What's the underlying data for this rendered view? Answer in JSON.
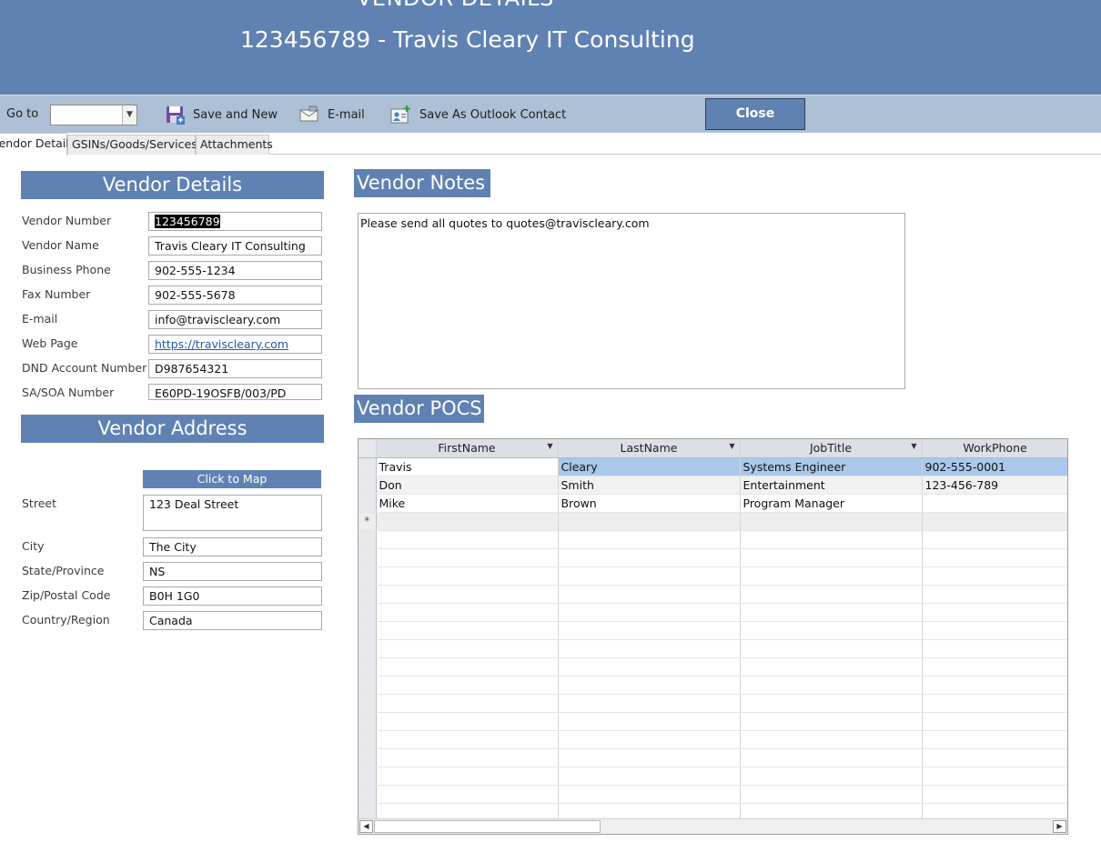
{
  "header": {
    "title": "VENDOR DETAILS",
    "subtitle": "123456789 - Travis Cleary IT Consulting"
  },
  "toolbar": {
    "goto_label": "Go to",
    "goto_value": "",
    "save_new_label": "Save and New",
    "email_label": "E-mail",
    "outlook_label": "Save As Outlook Contact",
    "close_label": "Close"
  },
  "tabs": [
    {
      "label": "Vendor Details"
    },
    {
      "label": "GSINs/Goods/Services"
    },
    {
      "label": "Attachments"
    }
  ],
  "vendor_details": {
    "heading": "Vendor Details",
    "fields": [
      {
        "label": "Vendor Number",
        "value": "123456789"
      },
      {
        "label": "Vendor Name",
        "value": "Travis Cleary IT Consulting"
      },
      {
        "label": "Business Phone",
        "value": "902-555-1234"
      },
      {
        "label": "Fax Number",
        "value": "902-555-5678"
      },
      {
        "label": "E-mail",
        "value": "info@traviscleary.com"
      },
      {
        "label": "Web Page",
        "value": "https://traviscleary.com"
      },
      {
        "label": "DND Account Number",
        "value": "D987654321"
      },
      {
        "label": "SA/SOA Number",
        "value": "E60PD-19OSFB/003/PD"
      }
    ]
  },
  "vendor_address": {
    "heading": "Vendor Address",
    "map_button": "Click to Map",
    "fields": [
      {
        "label": "Street",
        "value": "123 Deal Street"
      },
      {
        "label": "City",
        "value": "The City"
      },
      {
        "label": "State/Province",
        "value": "NS"
      },
      {
        "label": "Zip/Postal Code",
        "value": "B0H 1G0"
      },
      {
        "label": "Country/Region",
        "value": "Canada"
      }
    ]
  },
  "vendor_notes": {
    "heading": "Vendor Notes",
    "text": "Please send all quotes to quotes@traviscleary.com"
  },
  "vendor_pocs": {
    "heading": "Vendor POCS",
    "columns": [
      "FirstName",
      "LastName",
      "JobTitle",
      "WorkPhone"
    ],
    "rows": [
      [
        "Travis",
        "Cleary",
        "Systems Engineer",
        "902-555-0001"
      ],
      [
        "Don",
        "Smith",
        "Entertainment",
        "123-456-789"
      ],
      [
        "Mike",
        "Brown",
        "Program Manager",
        ""
      ]
    ],
    "new_record_marker": "*"
  },
  "colors": {
    "brand_blue": "#5f82b3",
    "toolbar_bg": "#aec0d6",
    "selected_row": "#a9c8ea"
  },
  "icons": [
    "dropdown-arrow-icon",
    "save-new-icon",
    "email-icon",
    "outlook-contact-icon",
    "scroll-left-icon",
    "scroll-right-icon"
  ]
}
